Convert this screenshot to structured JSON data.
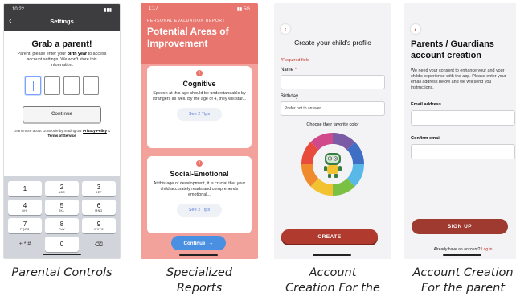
{
  "parental": {
    "time": "10:22",
    "signal": "▮▮▮",
    "nav_title": "Settings",
    "back_glyph": "‹",
    "heading": "Grab a parent!",
    "desc_before": "Parent, please enter your ",
    "desc_bold": "birth year",
    "desc_after": " to access account settings. We won't store this information.",
    "continue_label": "Continue",
    "legal_before": "Learn more about GoNoodle by reading our ",
    "privacy_label": "Privacy Policy",
    "legal_mid": " & ",
    "terms_label": "Terms of Service",
    "keys": [
      {
        "n": "1",
        "l": ""
      },
      {
        "n": "2",
        "l": "ABC"
      },
      {
        "n": "3",
        "l": "DEF"
      },
      {
        "n": "4",
        "l": "GHI"
      },
      {
        "n": "5",
        "l": "JKL"
      },
      {
        "n": "6",
        "l": "MNO"
      },
      {
        "n": "7",
        "l": "PQRS"
      },
      {
        "n": "8",
        "l": "TUV"
      },
      {
        "n": "9",
        "l": "WXYZ"
      }
    ],
    "key_symbols": "+ * #",
    "key_zero": "0",
    "key_delete": "⌫"
  },
  "reports": {
    "time": "1:17",
    "signal": "▮▮ 5G",
    "kicker": "PERSONAL EVALUATION REPORT",
    "title": "Potential Areas of Improvement",
    "cards": [
      {
        "title": "Cognitive",
        "text": "Speech at this age should be understandable by strangers as well. By the age of 4, they will star...",
        "tips": "See 2 Tips"
      },
      {
        "title": "Social-Emotional",
        "text": "At this age of development, it is crucial that your child accurately reads and comprehends emotional...",
        "tips": "See 2 Tips"
      }
    ],
    "warn_glyph": "!",
    "cta_label": "Continue",
    "cta_arrow": "→"
  },
  "child": {
    "back_glyph": "‹",
    "title": "Create your child's profile",
    "required_note": "*Required field",
    "name_label": "Name",
    "required_star": "*",
    "birthday_label": "Birthday",
    "birthday_value": "Prefer not to answer",
    "color_label": "Choose their favorite color",
    "wheel_colors": [
      "#7b5aa6",
      "#3f6fc5",
      "#58b9e8",
      "#7ac043",
      "#f2c230",
      "#ef8b2c",
      "#e84b3c",
      "#d04a8b"
    ],
    "create_label": "CREATE"
  },
  "parent": {
    "back_glyph": "‹",
    "title": "Parents / Guardians account creation",
    "desc": "We need your consent to enhance your and your child's experience with the app. Please enter your email address below and we will send you instructions.",
    "email_label": "Email address",
    "confirm_label": "Confirm email",
    "signup_label": "SIGN UP",
    "already_text": "Already have an account?",
    "login_label": "Log in"
  },
  "captions": [
    "Parental Controls",
    "Specialized Reports",
    "Account Creation For the child",
    "Account Creation For the parent"
  ]
}
